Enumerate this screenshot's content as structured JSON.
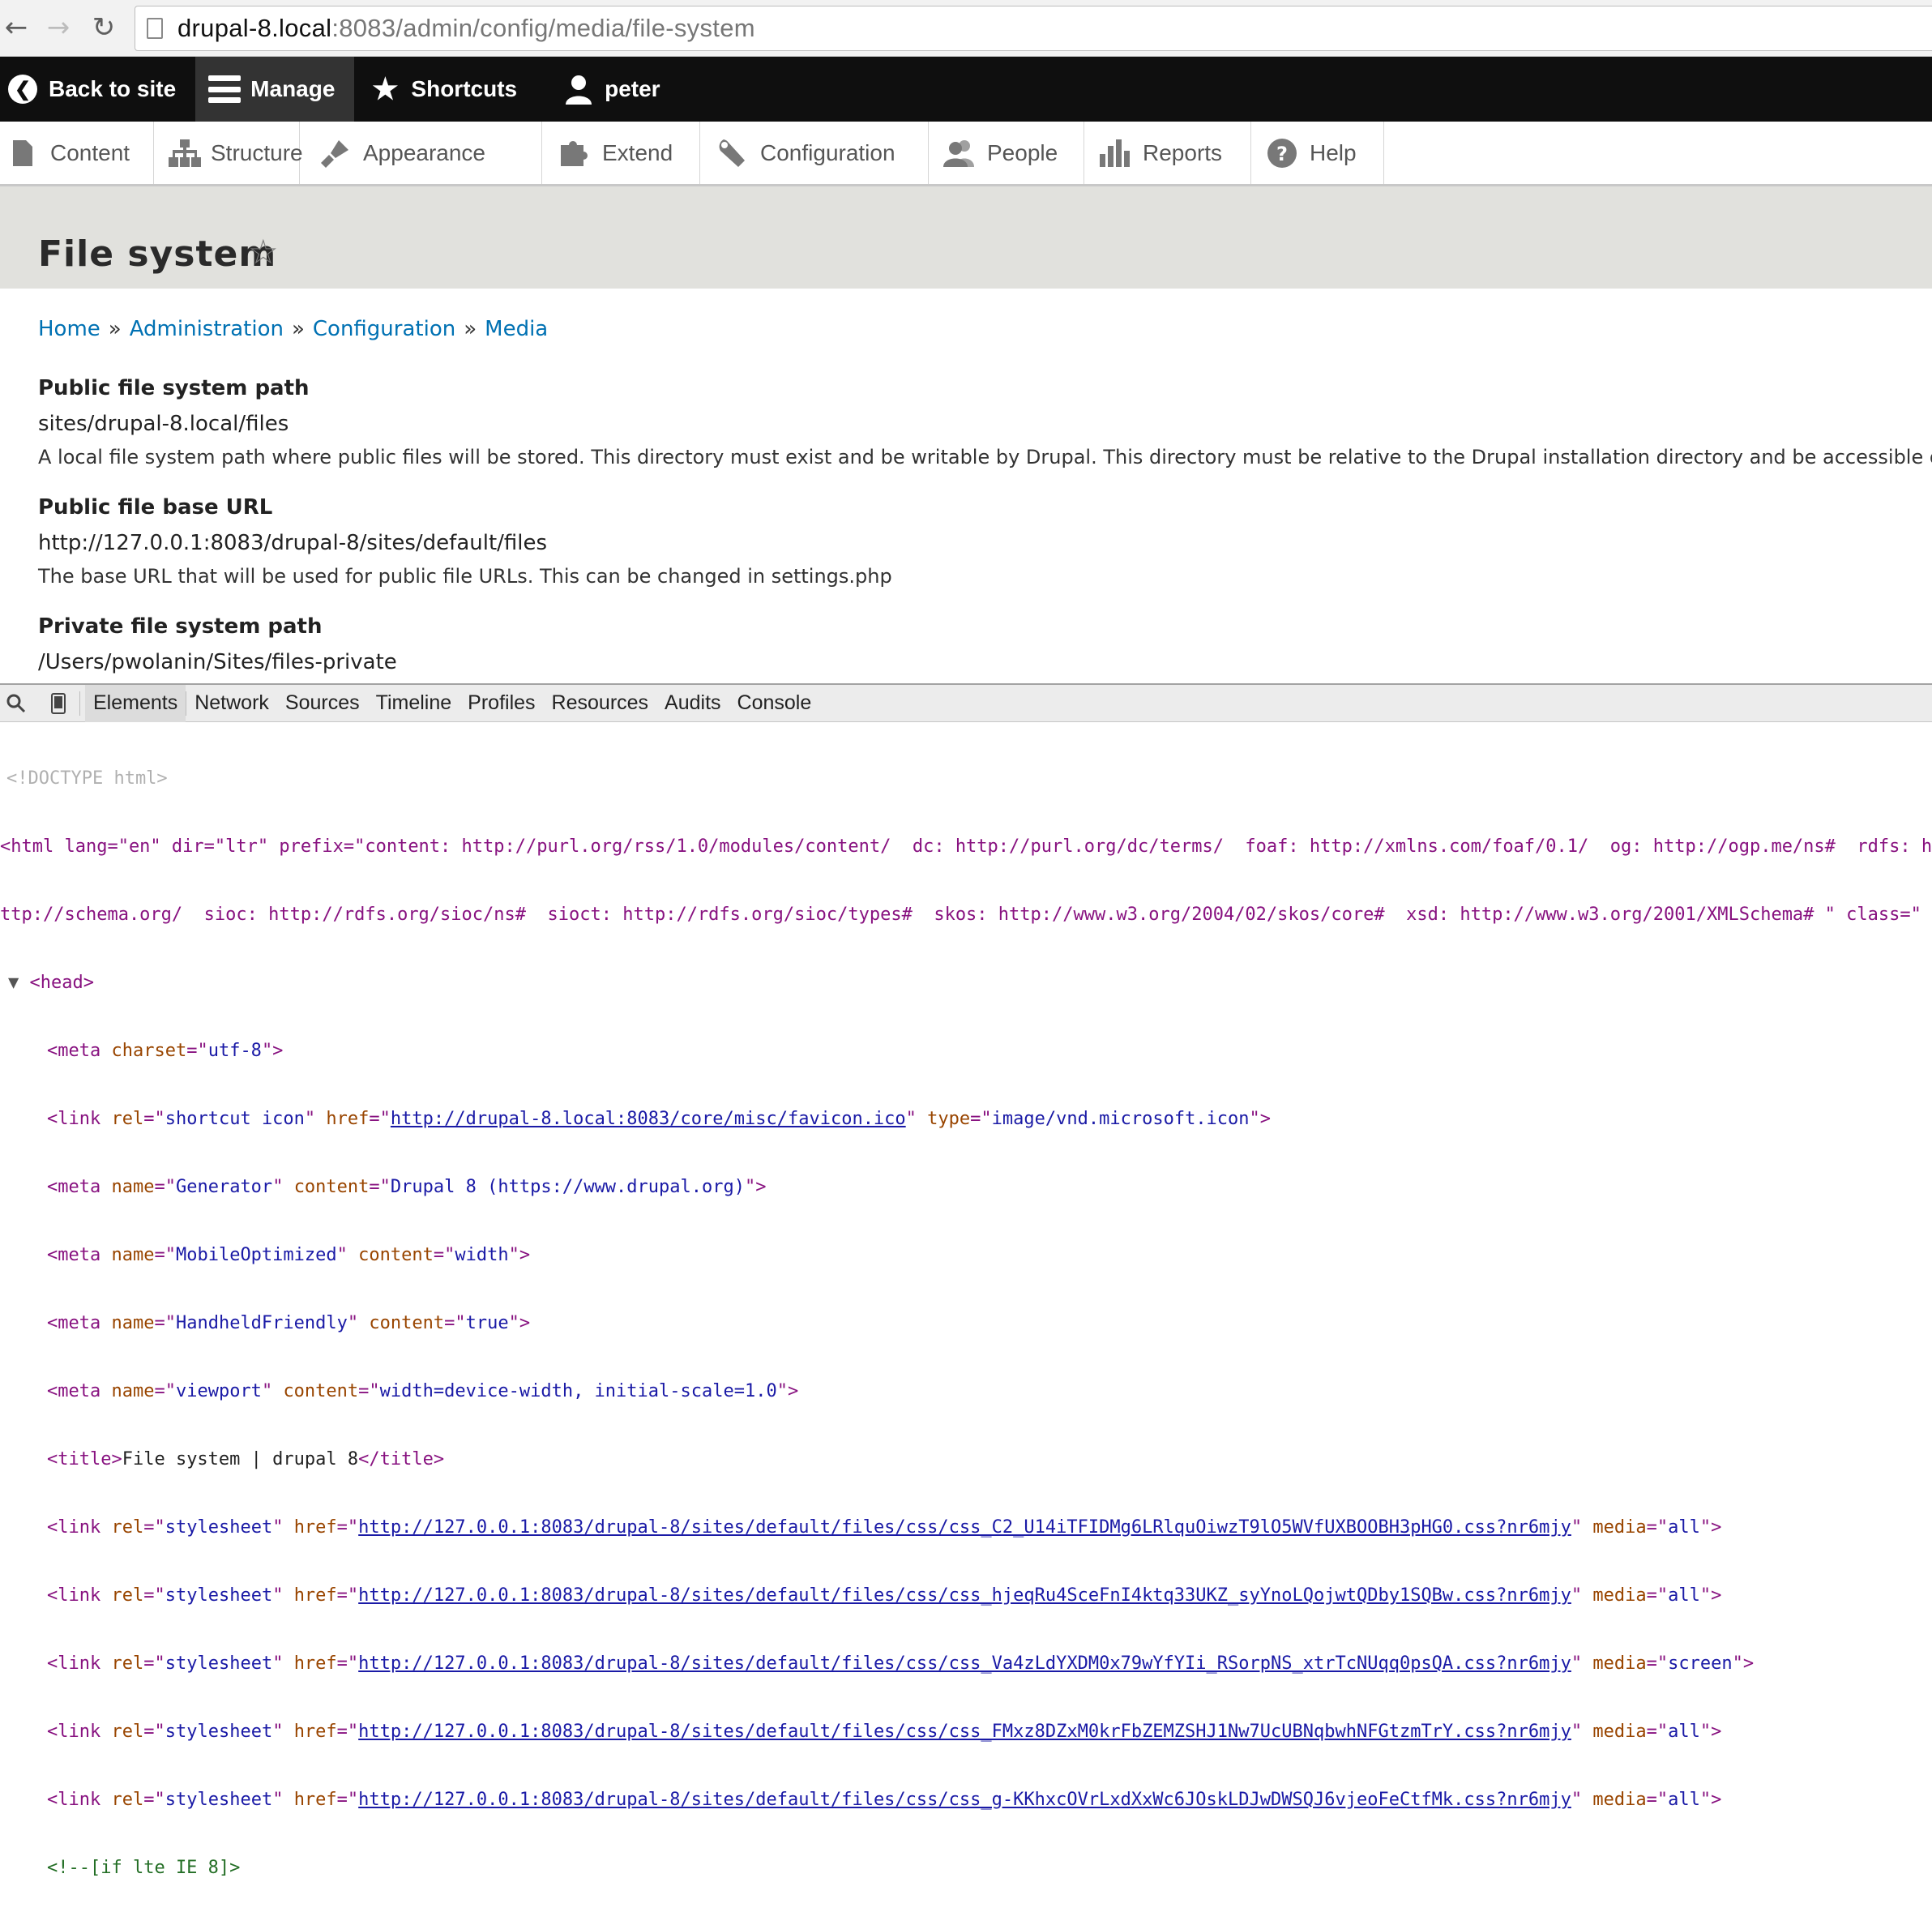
{
  "browser": {
    "url_host": "drupal-8.local",
    "url_rest": ":8083/admin/config/media/file-system"
  },
  "toolbar": {
    "back_label": "Back to site",
    "manage_label": "Manage",
    "shortcuts_label": "Shortcuts",
    "user_label": "peter"
  },
  "tray": {
    "items": [
      {
        "label": "Content",
        "icon": "file-icon"
      },
      {
        "label": "Structure",
        "icon": "sitemap-icon"
      },
      {
        "label": "Appearance",
        "icon": "brush-icon"
      },
      {
        "label": "Extend",
        "icon": "puzzle-icon"
      },
      {
        "label": "Configuration",
        "icon": "wrench-icon"
      },
      {
        "label": "People",
        "icon": "people-icon"
      },
      {
        "label": "Reports",
        "icon": "bar-chart-icon"
      },
      {
        "label": "Help",
        "icon": "help-icon"
      }
    ]
  },
  "page": {
    "title": "File system"
  },
  "breadcrumb": {
    "items": [
      "Home",
      "Administration",
      "Configuration",
      "Media"
    ],
    "separator": "»"
  },
  "fields": {
    "public_path": {
      "label": "Public file system path",
      "value": "sites/drupal-8.local/files",
      "description": "A local file system path where public files will be stored. This directory must exist and be writable by Drupal. This directory must be relative to the Drupal installation directory and be accessible o"
    },
    "public_url": {
      "label": "Public file base URL",
      "value": "http://127.0.0.1:8083/drupal-8/sites/default/files",
      "description": "The base URL that will be used for public file URLs. This can be changed in settings.php"
    },
    "private_path": {
      "label": "Private file system path",
      "value": "/Users/pwolanin/Sites/files-private"
    }
  },
  "devtools": {
    "tabs": [
      "Elements",
      "Network",
      "Sources",
      "Timeline",
      "Profiles",
      "Resources",
      "Audits",
      "Console"
    ],
    "active_tab": "Elements",
    "code": {
      "doctype": "<!DOCTYPE html>",
      "html_line1": "<html lang=\"en\" dir=\"ltr\" prefix=\"content: http://purl.org/rss/1.0/modules/content/  dc: http://purl.org/dc/terms/  foaf: http://xmlns.com/foaf/0.1/  og: http://ogp.me/ns#  rdfs: h",
      "html_line2": "ttp://schema.org/  sioc: http://rdfs.org/sioc/ns#  sioct: http://rdfs.org/sioc/types#  skos: http://www.w3.org/2004/02/skos/core#  xsd: http://www.w3.org/2001/XMLSchema# \" class=\"",
      "head": "<head>",
      "meta_charset": "utf-8",
      "favicon_href": "http://drupal-8.local:8083/core/misc/favicon.ico",
      "favicon_type": "image/vnd.microsoft.icon",
      "generator": "Drupal 8 (https://www.drupal.org)",
      "mobile": "width",
      "handheld": "true",
      "viewport": "width=device-width, initial-scale=1.0",
      "title_text": "File system | drupal 8",
      "stylesheets": [
        {
          "href": "http://127.0.0.1:8083/drupal-8/sites/default/files/css/css_C2_U14iTFIDMg6LRlquOiwzT9lO5WVfUXBOOBH3pHG0.css?nr6mjy",
          "media": "all"
        },
        {
          "href": "http://127.0.0.1:8083/drupal-8/sites/default/files/css/css_hjeqRu4SceFnI4ktq33UKZ_syYnoLQojwtQDby1SQBw.css?nr6mjy",
          "media": "all"
        },
        {
          "href": "http://127.0.0.1:8083/drupal-8/sites/default/files/css/css_Va4zLdYXDM0x79wYfYIi_RSorpNS_xtrTcNUqq0psQA.css?nr6mjy",
          "media": "screen"
        },
        {
          "href": "http://127.0.0.1:8083/drupal-8/sites/default/files/css/css_FMxz8DZxM0krFbZEMZSHJ1Nw7UcUBNqbwhNFGtzmTrY.css?nr6mjy",
          "media": "all"
        },
        {
          "href": "http://127.0.0.1:8083/drupal-8/sites/default/files/css/css_g-KKhxcOVrLxdXxWc6JOskLDJwDWSQJ6vjeoFeCtfMk.css?nr6mjy",
          "media": "all"
        }
      ],
      "comment": "<!--[if lte IE 8]>"
    }
  }
}
